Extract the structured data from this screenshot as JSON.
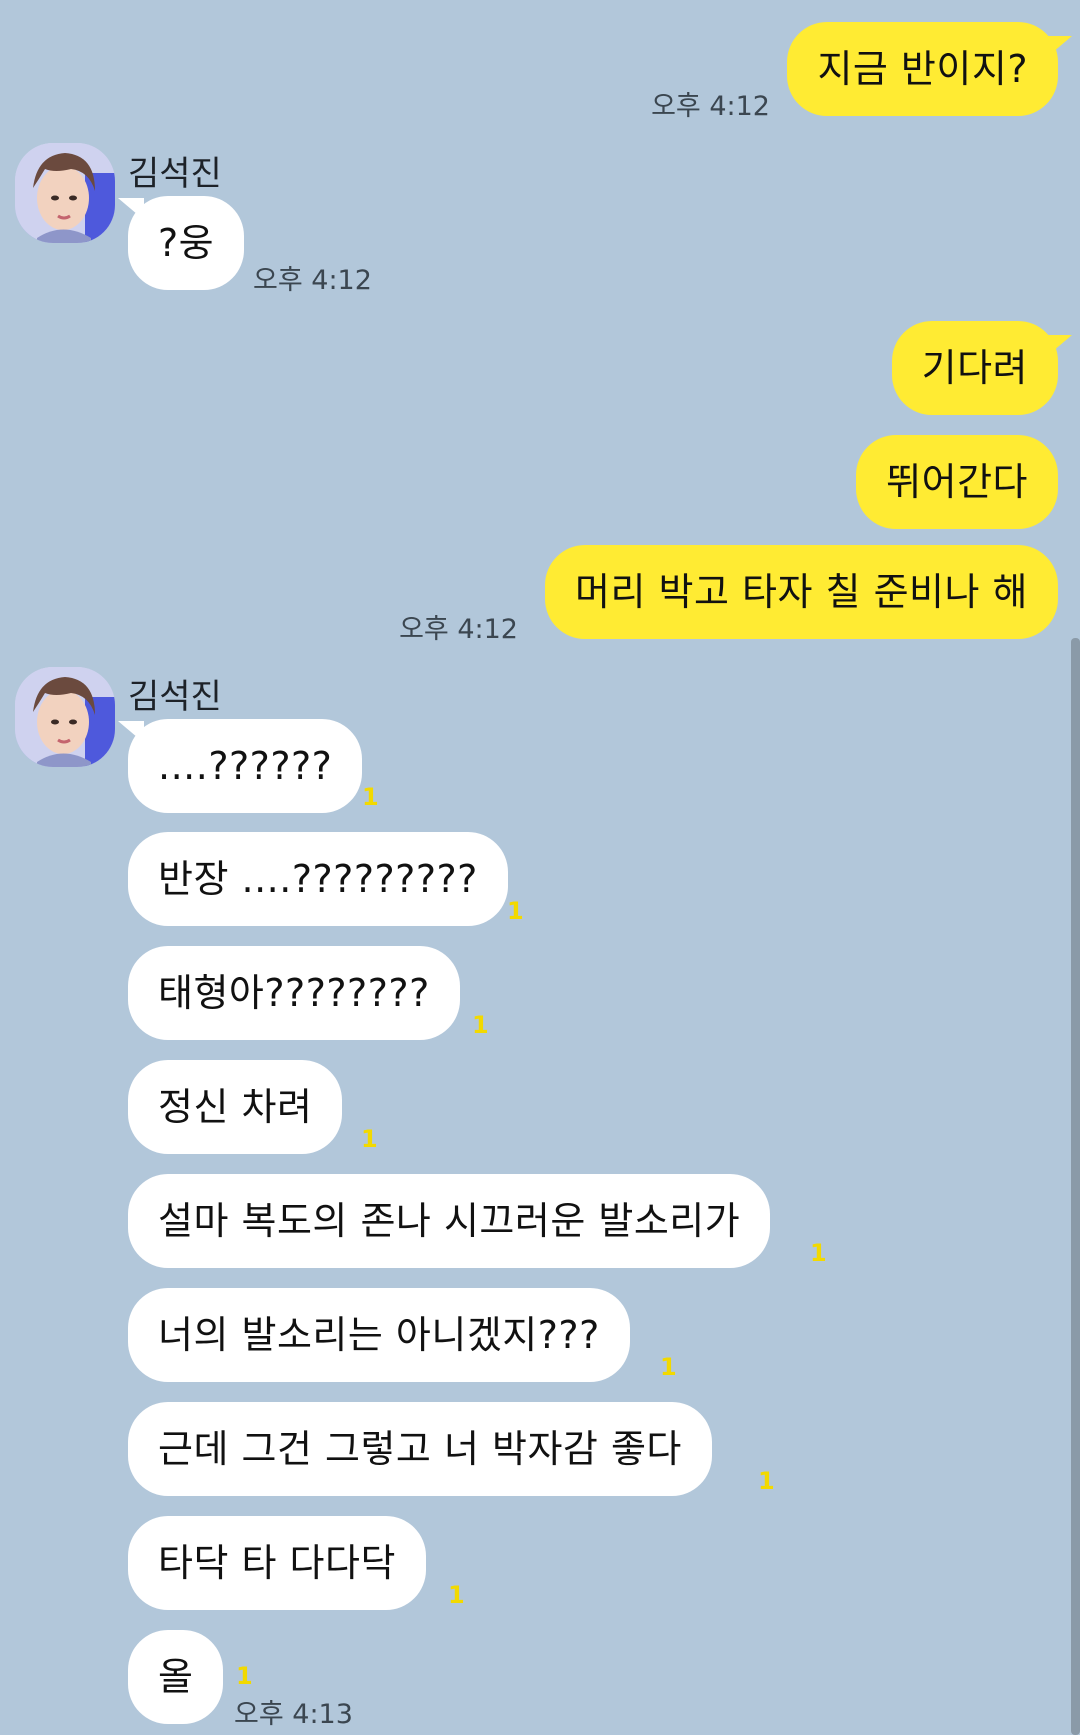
{
  "chat": {
    "messages": [
      {
        "from": "me",
        "text": "지금 반이지?"
      },
      {
        "from": "me",
        "time": "오후 4:12"
      },
      {
        "from": "other",
        "sender": "김석진",
        "text": "?웅",
        "time": "오후 4:12"
      },
      {
        "from": "me",
        "text": "기다려"
      },
      {
        "from": "me",
        "text": "뛰어간다"
      },
      {
        "from": "me",
        "text": "머리 박고 타자 칠 준비나 해",
        "time": "오후 4:12"
      },
      {
        "from": "other",
        "sender": "김석진",
        "text": "....??????",
        "unread": "1"
      },
      {
        "from": "other",
        "text": "반장 ....?????????",
        "unread": "1"
      },
      {
        "from": "other",
        "text": "태형아????????",
        "unread": "1"
      },
      {
        "from": "other",
        "text": "정신 차려",
        "unread": "1"
      },
      {
        "from": "other",
        "text": "설마 복도의 존나 시끄러운 발소리가",
        "unread": "1"
      },
      {
        "from": "other",
        "text": "너의 발소리는 아니겠지???",
        "unread": "1"
      },
      {
        "from": "other",
        "text": "근데 그건 그렇고 너 박자감 좋다",
        "unread": "1"
      },
      {
        "from": "other",
        "text": "타닥 타 다다닥",
        "unread": "1"
      },
      {
        "from": "other",
        "text": "올",
        "unread": "1",
        "time": "오후 4:13"
      }
    ]
  },
  "colors": {
    "background": "#b2c7da",
    "my_bubble": "#ffeb33",
    "their_bubble": "#ffffff",
    "unread_count": "#f2d900"
  },
  "icons": {
    "avatar": "profile-photo"
  }
}
